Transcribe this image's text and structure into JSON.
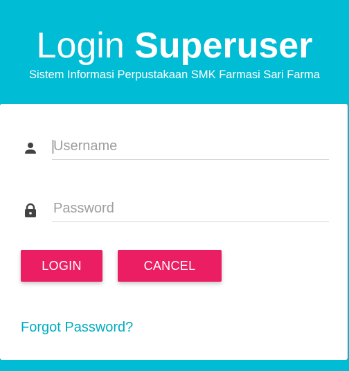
{
  "header": {
    "title_light": "Login",
    "title_bold": "Superuser",
    "subtitle": "Sistem Informasi Perpustakaan SMK Farmasi Sari Farma"
  },
  "form": {
    "username": {
      "placeholder": "Username",
      "value": "",
      "icon": "person-icon"
    },
    "password": {
      "placeholder": "Password",
      "value": "",
      "icon": "lock-icon"
    },
    "login_label": "LOGIN",
    "cancel_label": "CANCEL",
    "forgot_label": "Forgot Password?"
  },
  "colors": {
    "primary": "#00bcd4",
    "accent": "#ec1e63",
    "link": "#00acc1"
  }
}
